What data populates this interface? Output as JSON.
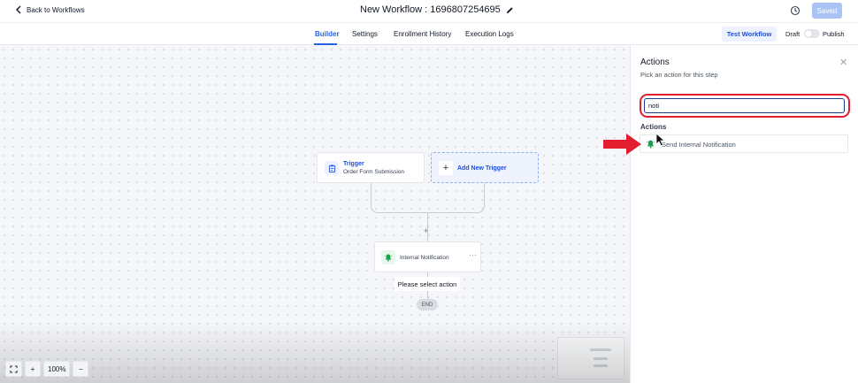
{
  "header": {
    "back_label": "Back to Workflows",
    "title": "New Workflow : 1696807254695",
    "saved_label": "Saved"
  },
  "subnav": {
    "tabs": [
      {
        "label": "Builder",
        "active": true
      },
      {
        "label": "Settings",
        "active": false
      },
      {
        "label": "Enrollment History",
        "active": false
      },
      {
        "label": "Execution Logs",
        "active": false
      }
    ],
    "test_label": "Test Workflow",
    "draft_label": "Draft",
    "publish_label": "Publish"
  },
  "canvas": {
    "trigger": {
      "title": "Trigger",
      "subtitle": "Order Form Submission"
    },
    "add_trigger_label": "Add New Trigger",
    "action": {
      "label": "Internal Notification",
      "more": "···"
    },
    "select_action_label": "Please select action",
    "end_label": "END",
    "zoom": {
      "level": "100%",
      "plus": "+",
      "minus": "−"
    }
  },
  "panel": {
    "title": "Actions",
    "subtitle": "Pick an action for this step",
    "search_value": "noti",
    "section_label": "Actions",
    "results": [
      {
        "label": "Send Internal Notification",
        "icon": "notification-bell-icon"
      }
    ]
  },
  "colors": {
    "accent": "#2563eb",
    "highlight_red": "#e11d2e",
    "notification_green": "#16a34a"
  }
}
